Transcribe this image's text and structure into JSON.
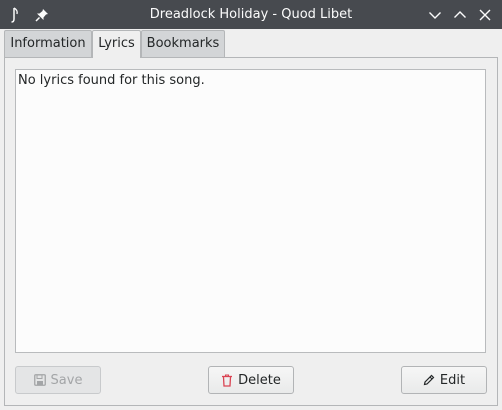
{
  "window": {
    "title": "Dreadlock Holiday - Quod Libet"
  },
  "tabs": [
    {
      "label": "Information",
      "active": false
    },
    {
      "label": "Lyrics",
      "active": true
    },
    {
      "label": "Bookmarks",
      "active": false
    }
  ],
  "lyrics": {
    "text": "No lyrics found for this song."
  },
  "buttons": {
    "save_label": "Save",
    "delete_label": "Delete",
    "edit_label": "Edit"
  },
  "icons": {
    "app": "quodlibet-app-icon",
    "pin": "pin-icon",
    "minimize": "chevron-down-icon",
    "maximize": "chevron-up-icon",
    "close": "close-icon",
    "save": "floppy-disk-icon",
    "delete": "trash-icon",
    "edit": "pencil-icon"
  },
  "colors": {
    "titlebar": "#474a4f",
    "delete_icon": "#da4453"
  }
}
